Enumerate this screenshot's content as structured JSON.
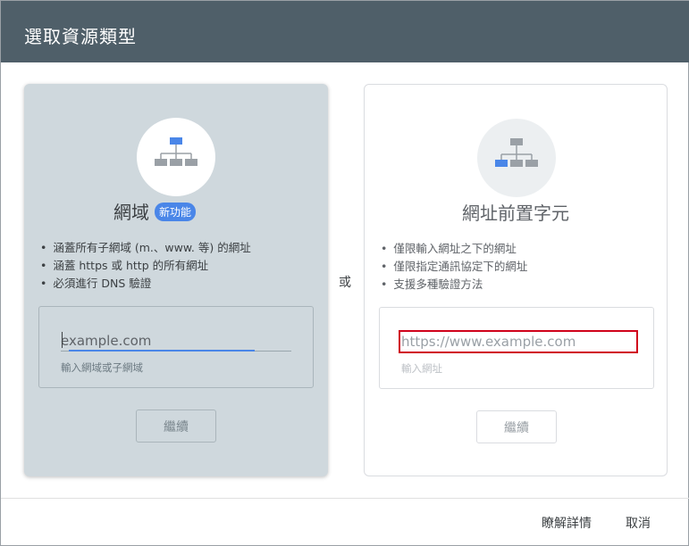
{
  "dialog": {
    "title": "選取資源類型",
    "or_label": "或"
  },
  "domain_card": {
    "title": "網域",
    "badge": "新功能",
    "bullets": [
      "涵蓋所有子網域 (m.、www. 等) 的網址",
      "涵蓋 https 或 http 的所有網址",
      "必須進行 DNS 驗證"
    ],
    "input_placeholder": "example.com",
    "helper": "輸入網域或子網域",
    "continue_label": "繼續",
    "icon": "sitemap-root-icon"
  },
  "prefix_card": {
    "title": "網址前置字元",
    "bullets": [
      "僅限輸入網址之下的網址",
      "僅限指定通訊協定下的網址",
      "支援多種驗證方法"
    ],
    "input_placeholder": "https://www.example.com",
    "helper": "輸入網址",
    "continue_label": "繼續",
    "icon": "sitemap-leaf-icon"
  },
  "footer": {
    "learn_more": "瞭解詳情",
    "cancel": "取消"
  },
  "colors": {
    "header": "#4f5f69",
    "accent": "#4a86e8",
    "highlight": "#d0021b",
    "selected_card": "#cfd8dd"
  }
}
